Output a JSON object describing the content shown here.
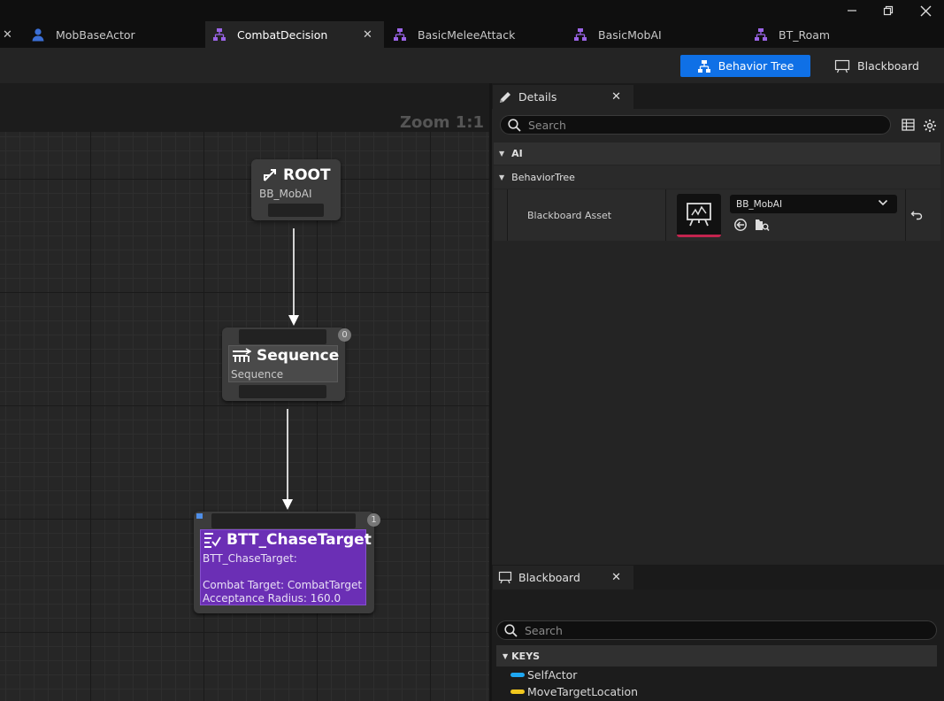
{
  "tabs": [
    {
      "label": "MobBaseActor",
      "icon": "person-icon",
      "active": false
    },
    {
      "label": "CombatDecision",
      "icon": "behavior-tree-icon",
      "active": true
    },
    {
      "label": "BasicMeleeAttack",
      "icon": "behavior-tree-icon",
      "active": false
    },
    {
      "label": "BasicMobAI",
      "icon": "behavior-tree-icon",
      "active": false
    },
    {
      "label": "BT_Roam",
      "icon": "behavior-tree-icon",
      "active": false
    }
  ],
  "toolbar": {
    "behavior_tree_label": "Behavior Tree",
    "blackboard_label": "Blackboard"
  },
  "graph": {
    "zoom": "Zoom 1:1",
    "nodes": {
      "root": {
        "title": "ROOT",
        "subtitle": "BB_MobAI"
      },
      "sequence": {
        "title": "Sequence",
        "subtitle": "Sequence",
        "index": "0"
      },
      "task": {
        "title": "BTT_ChaseTarget",
        "subtitle": "BTT_ChaseTarget:",
        "line1": "Combat Target: CombatTarget",
        "line2": "Acceptance Radius: 160.0",
        "index": "1"
      }
    }
  },
  "details": {
    "tab_label": "Details",
    "search_placeholder": "Search",
    "category_ai": "AI",
    "category_behavior_tree": "BehaviorTree",
    "property_name": "Blackboard Asset",
    "property_value": "BB_MobAI"
  },
  "blackboard": {
    "tab_label": "Blackboard",
    "search_placeholder": "Search",
    "keys_header": "KEYS",
    "keys": [
      {
        "name": "SelfActor",
        "color": "#1ea7f2"
      },
      {
        "name": "MoveTargetLocation",
        "color": "#f2c81e"
      }
    ]
  },
  "colors": {
    "accent": "#0f70e6",
    "task_node": "#6b2fb5",
    "asset_underline": "#c3244e"
  }
}
